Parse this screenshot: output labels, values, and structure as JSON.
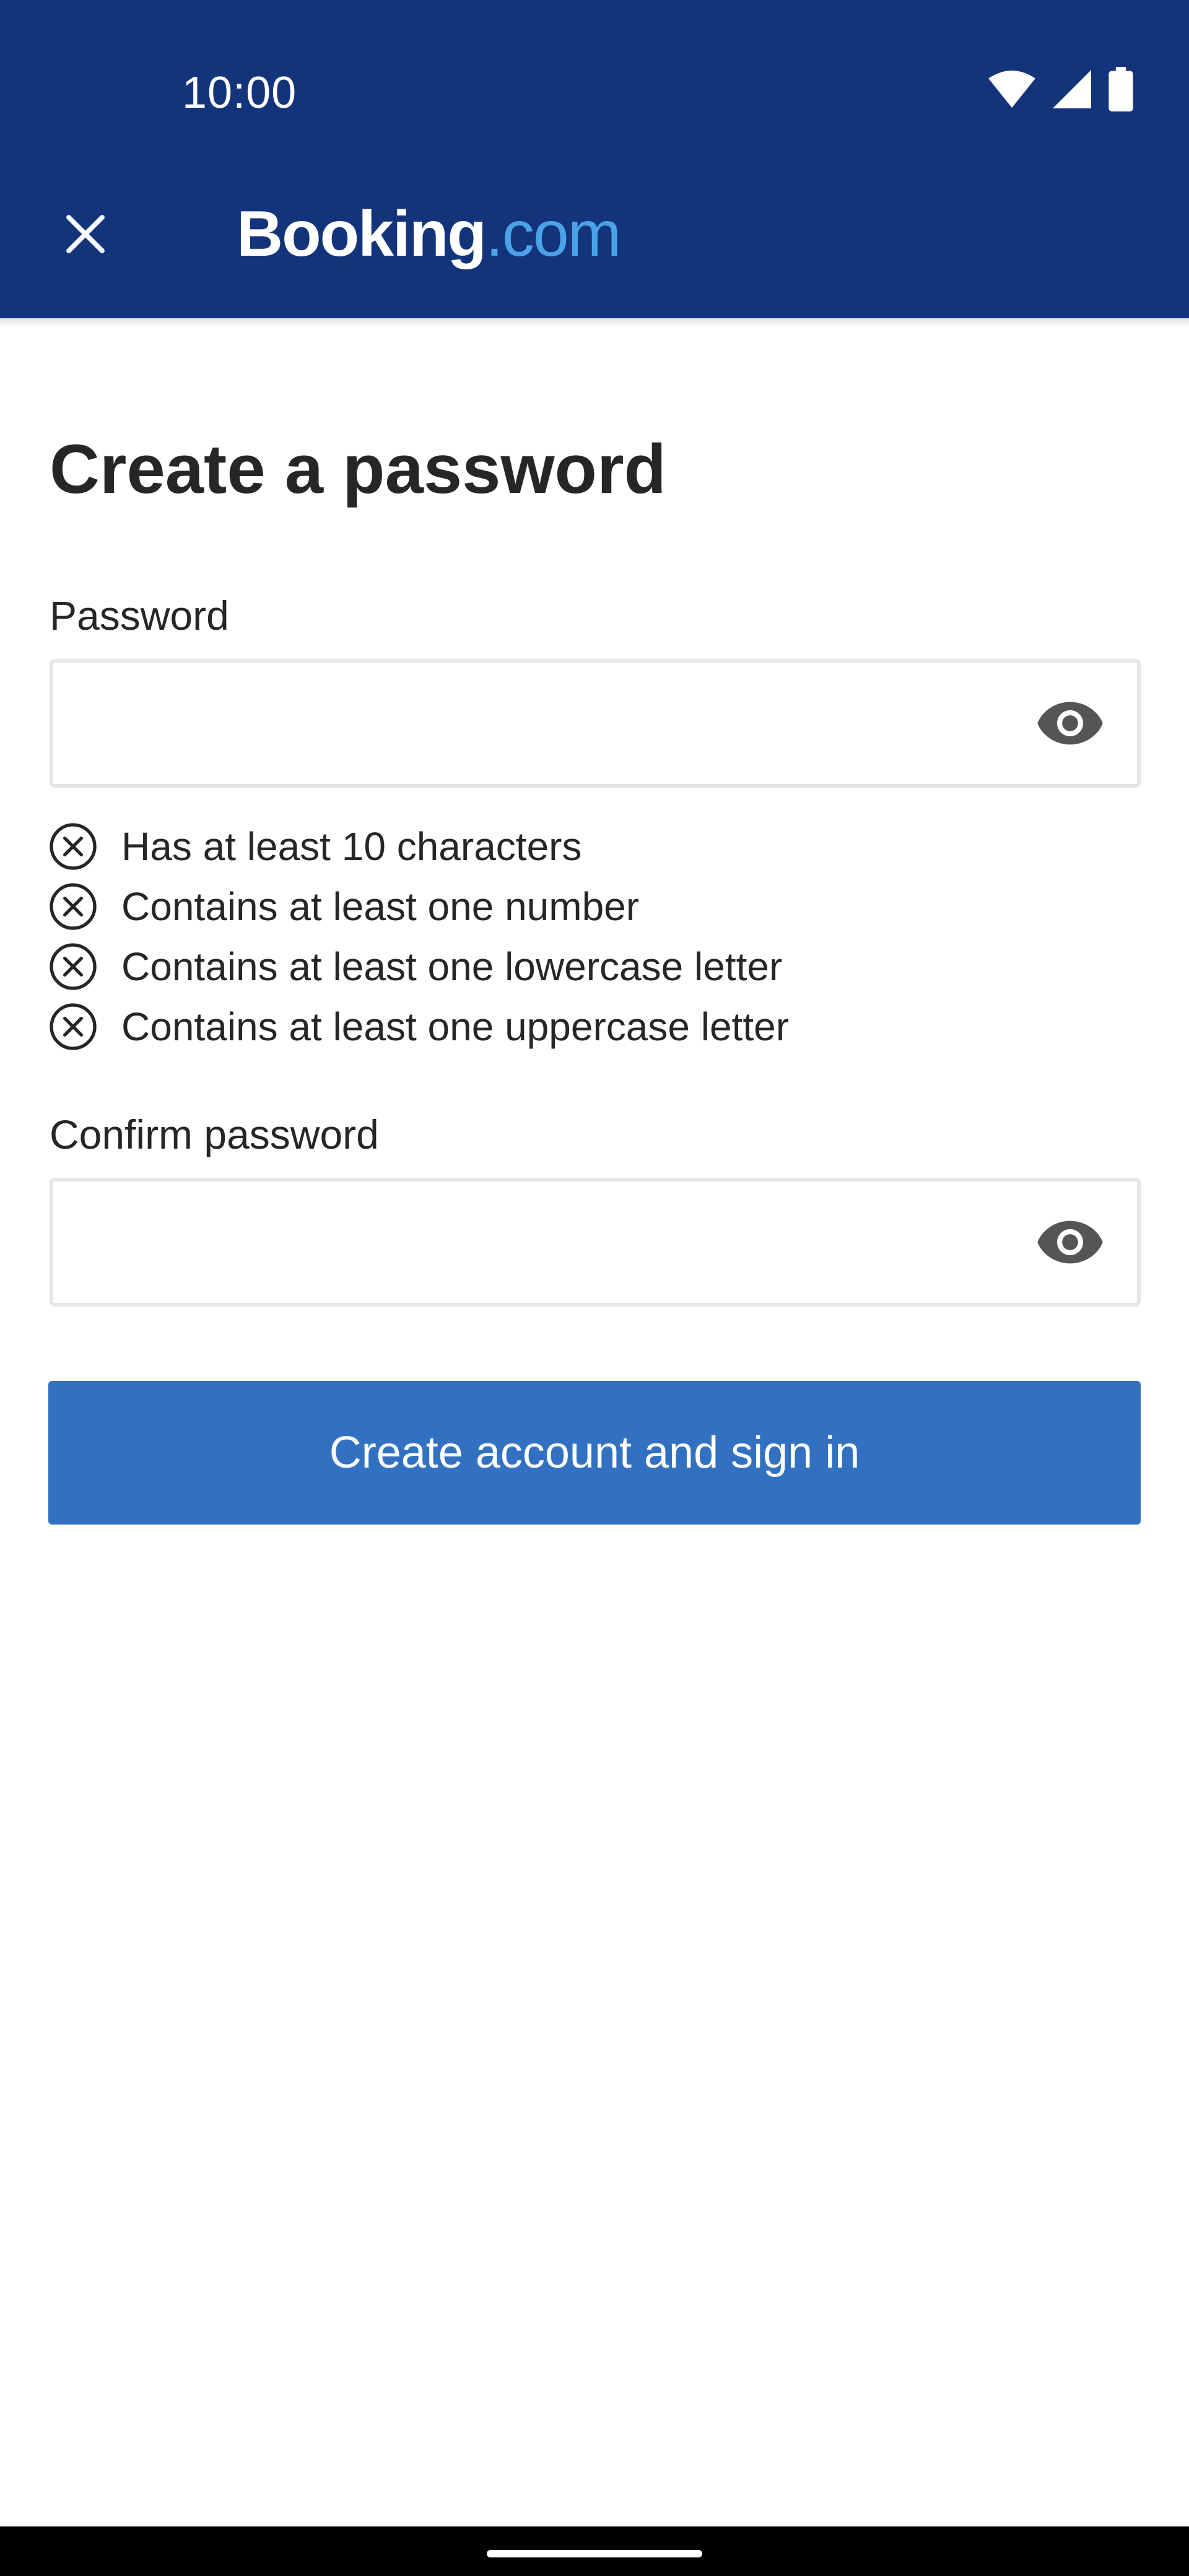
{
  "status_bar": {
    "time": "10:00",
    "icons": [
      "wifi-icon",
      "cell-signal-icon",
      "battery-icon"
    ]
  },
  "header": {
    "close_icon": "close-icon",
    "logo_main": "Booking",
    "logo_tld": ".com"
  },
  "page": {
    "title": "Create a password"
  },
  "password": {
    "label": "Password",
    "value": "",
    "placeholder": "",
    "toggle_icon": "eye-icon"
  },
  "requirements": [
    {
      "text": "Has at least 10 characters",
      "met": false
    },
    {
      "text": "Contains at least one number",
      "met": false
    },
    {
      "text": "Contains at least one lowercase letter",
      "met": false
    },
    {
      "text": "Contains at least one uppercase letter",
      "met": false
    }
  ],
  "confirm_password": {
    "label": "Confirm password",
    "value": "",
    "placeholder": "",
    "toggle_icon": "eye-icon"
  },
  "submit": {
    "label": "Create account and sign in"
  },
  "colors": {
    "header_bg": "#13347a",
    "logo_tld": "#4aa3e8",
    "primary_button": "#3271c1",
    "text": "#262626",
    "field_border": "#e6e6e6",
    "icon_grey": "#555555"
  }
}
